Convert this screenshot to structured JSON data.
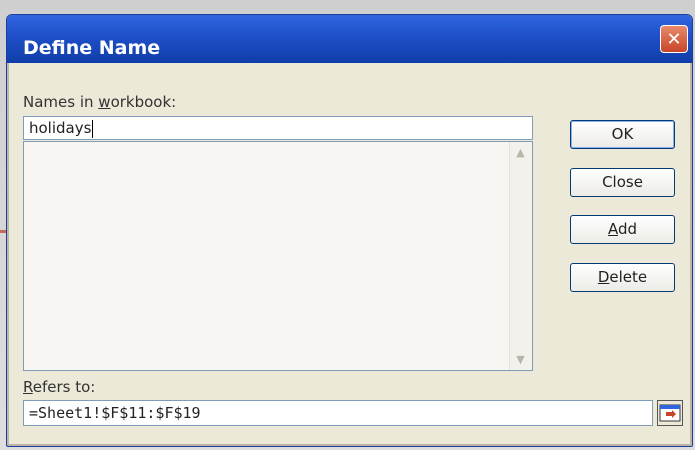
{
  "window": {
    "title": "Define Name",
    "close_glyph": "✕"
  },
  "names": {
    "label_pre": "Names in ",
    "label_underlined": "w",
    "label_post": "orkbook:",
    "value": "holidays"
  },
  "buttons": {
    "ok": "OK",
    "close": "Close",
    "add_underlined": "A",
    "add_rest": "dd",
    "delete_underlined": "D",
    "delete_rest": "elete"
  },
  "refers": {
    "label_underlined": "R",
    "label_rest": "efers to:",
    "value": "=Sheet1!$F$11:$F$19"
  },
  "icons": {
    "scroll_up": "up-arrow-icon",
    "scroll_down": "down-arrow-icon",
    "collapse": "collapse-dialog-icon"
  }
}
